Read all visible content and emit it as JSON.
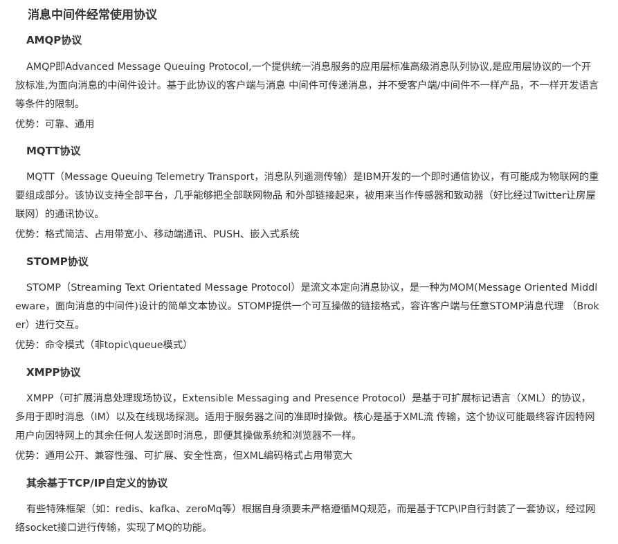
{
  "title": "消息中间件经常使用协议",
  "sections": [
    {
      "heading": "AMQP协议",
      "body": "AMQP即Advanced Message Queuing Protocol,一个提供统一消息服务的应用层标准高级消息队列协议,是应用层协议的一个开放标准,为面向消息的中间件设计。基于此协议的客户端与消息 中间件可传递消息，并不受客户端/中间件不一样产品，不一样开发语言等条件的限制。",
      "advantages": "优势：可靠、通用"
    },
    {
      "heading": "MQTT协议",
      "body": "MQTT（Message Queuing Telemetry Transport，消息队列遥测传输）是IBM开发的一个即时通信协议，有可能成为物联网的重要组成部分。该协议支持全部平台，几乎能够把全部联网物品 和外部链接起来，被用来当作传感器和致动器（好比经过Twitter让房屋联网）的通讯协议。",
      "advantages": "优势：格式简洁、占用带宽小、移动端通讯、PUSH、嵌入式系统"
    },
    {
      "heading": "STOMP协议",
      "body": "STOMP（Streaming Text Orientated Message Protocol）是流文本定向消息协议，是一种为MOM(Message Oriented Middleware，面向消息的中间件)设计的简单文本协议。STOMP提供一个可互操做的链接格式，容许客户端与任意STOMP消息代理 （Broker）进行交互。",
      "advantages": "优势：命令模式（非topic\\queue模式）"
    },
    {
      "heading": "XMPP协议",
      "body": "XMPP（可扩展消息处理现场协议，Extensible Messaging and Presence Protocol）是基于可扩展标记语言（XML）的协议，多用于即时消息（IM）以及在线现场探测。适用于服务器之间的准即时操做。核心是基于XML流 传输，这个协议可能最终容许因特网用户向因特网上的其余任何人发送即时消息，即便其操做系统和浏览器不一样。",
      "advantages": "优势：通用公开、兼容性强、可扩展、安全性高，但XML编码格式占用带宽大"
    },
    {
      "heading": "其余基于TCP/IP自定义的协议",
      "body": "有些特殊框架（如：redis、kafka、zeroMq等）根据自身须要未严格遵循MQ规范，而是基于TCP\\IP自行封装了一套协议，经过网络socket接口进行传输，实现了MQ的功能。",
      "advantages": ""
    }
  ]
}
